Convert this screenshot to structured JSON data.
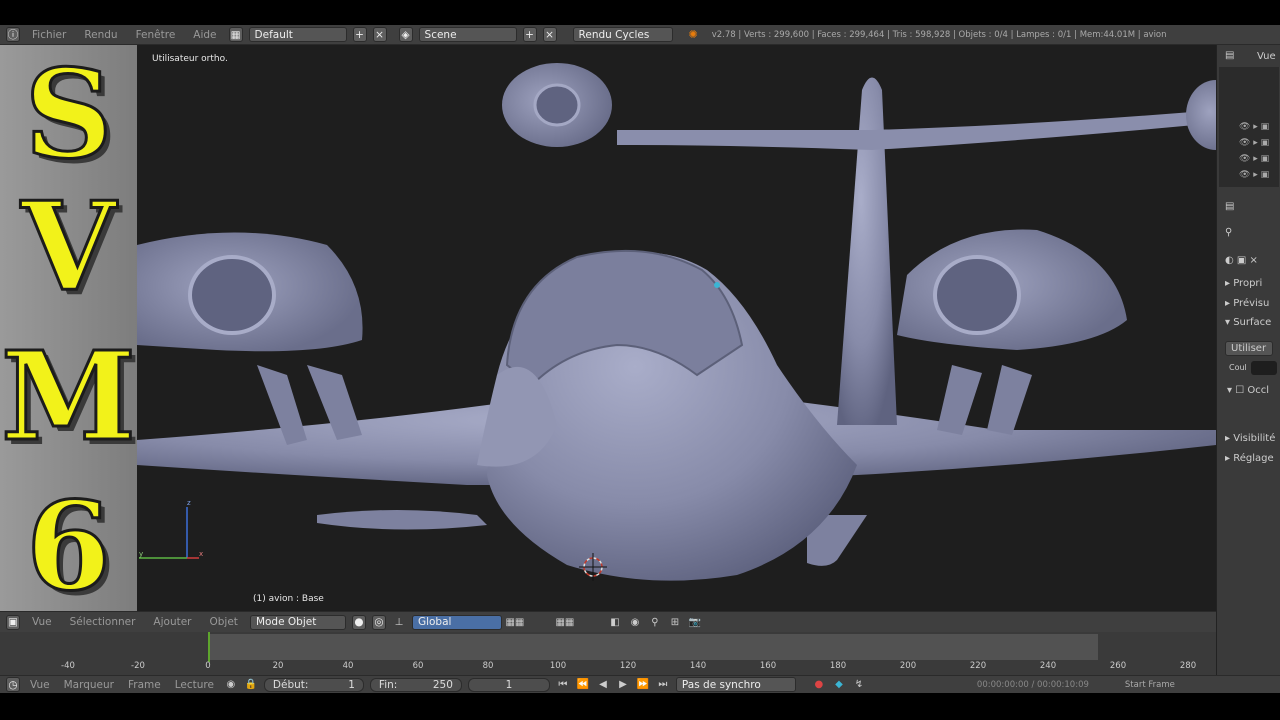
{
  "topbar": {
    "menus": [
      "Fichier",
      "Rendu",
      "Fenêtre",
      "Aide"
    ],
    "layout": "Default",
    "scene": "Scene",
    "engine": "Rendu Cycles",
    "stats": "v2.78 | Verts : 299,600 | Faces : 299,464 | Tris : 598,928 | Objets : 0/4 | Lampes : 0/1 | Mem:44.01M | avion"
  },
  "banner": {
    "letters": [
      "S",
      "V",
      "M",
      "6"
    ],
    "color": "#f2f21a"
  },
  "viewport": {
    "view_label": "Utilisateur ortho.",
    "object_label": "(1) avion : Base",
    "axis_x": "x",
    "axis_y": "y",
    "axis_z": "z"
  },
  "rightpanel": {
    "outliner_view": "Vue",
    "sections": [
      "Propri",
      "Prévisu",
      "Surface",
      "Utiliser",
      "Coul",
      "Occl",
      "Visibilité",
      "Réglage"
    ]
  },
  "viewport_header": {
    "menus": [
      "Vue",
      "Sélectionner",
      "Ajouter",
      "Objet"
    ],
    "mode": "Mode Objet",
    "orientation": "Global"
  },
  "timeline": {
    "ticks": [
      "-40",
      "-20",
      "0",
      "20",
      "40",
      "60",
      "80",
      "100",
      "120",
      "140",
      "160",
      "180",
      "200",
      "220",
      "240",
      "260",
      "280"
    ],
    "menus": [
      "Vue",
      "Marqueur",
      "Frame",
      "Lecture"
    ],
    "start_label": "Début:",
    "start_value": "1",
    "end_label": "Fin:",
    "end_value": "250",
    "current_frame": "1",
    "sync": "Pas de synchro",
    "timecode": "00:00:00:00 / 00:00:10:09",
    "start_frame_label": "Start Frame"
  },
  "colors": {
    "viewport_bg": "#1e1e1e",
    "model": "#8b8fae",
    "panel": "#3f3f3f"
  }
}
